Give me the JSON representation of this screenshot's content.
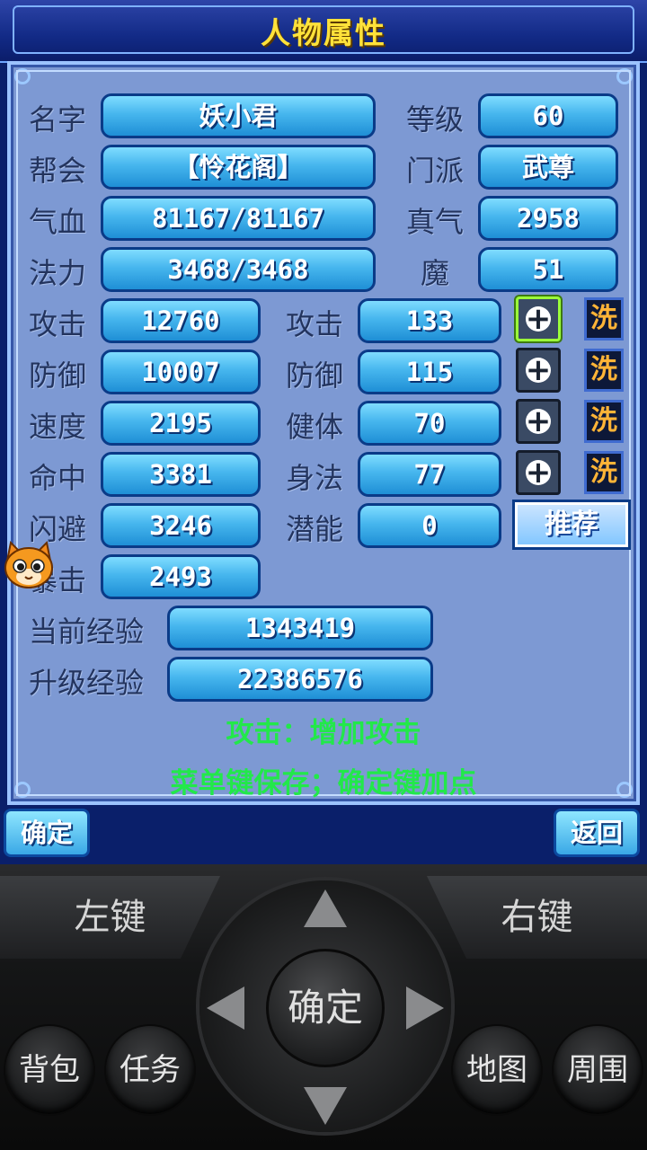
{
  "title": "人物属性",
  "info": {
    "name_label": "名字",
    "name_value": "妖小君",
    "level_label": "等级",
    "level_value": "60",
    "guild_label": "帮会",
    "guild_value": "【怜花阁】",
    "sect_label": "门派",
    "sect_value": "武尊",
    "hp_label": "气血",
    "hp_value": "81167/81167",
    "qi_label": "真气",
    "qi_value": "2958",
    "mp_label": "法力",
    "mp_value": "3468/3468",
    "demon_label": "魔",
    "demon_value": "51"
  },
  "stats_left": [
    {
      "label": "攻击",
      "value": "12760"
    },
    {
      "label": "防御",
      "value": "10007"
    },
    {
      "label": "速度",
      "value": "2195"
    },
    {
      "label": "命中",
      "value": "3381"
    },
    {
      "label": "闪避",
      "value": "3246"
    },
    {
      "label": "暴击",
      "value": "2493"
    }
  ],
  "stats_right": [
    {
      "label": "攻击",
      "value": "133",
      "wash": "洗"
    },
    {
      "label": "防御",
      "value": "115",
      "wash": "洗"
    },
    {
      "label": "健体",
      "value": "70",
      "wash": "洗"
    },
    {
      "label": "身法",
      "value": "77",
      "wash": "洗"
    },
    {
      "label": "潜能",
      "value": "0"
    }
  ],
  "recommend_label": "推荐",
  "exp": {
    "current_label": "当前经验",
    "current_value": "1343419",
    "next_label": "升级经验",
    "next_value": "22386576"
  },
  "hint_line1": "攻击：增加攻击",
  "hint_line2": "菜单键保存；确定键加点",
  "softkeys": {
    "ok": "确定",
    "back": "返回"
  },
  "controller": {
    "left_key": "左键",
    "right_key": "右键",
    "center": "确定",
    "bag": "背包",
    "task": "任务",
    "map": "地图",
    "nearby": "周围"
  },
  "colors": {
    "panel": "#7d99d3",
    "field": "#46b6ee",
    "title": "#ffe23a",
    "hint": "#22e84a"
  }
}
